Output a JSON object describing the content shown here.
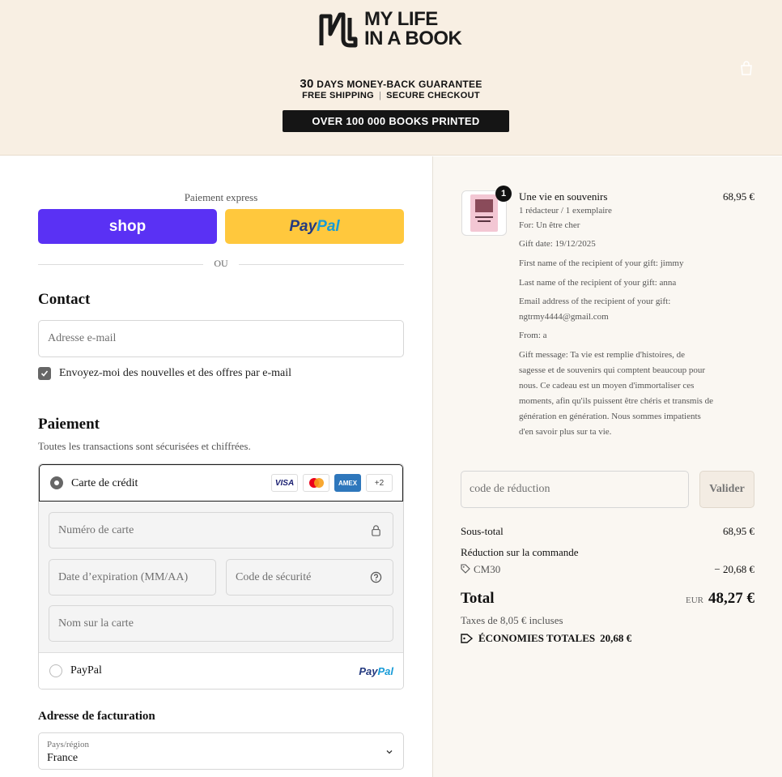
{
  "header": {
    "brand_line1": "MY LIFE",
    "brand_line2": "IN A BOOK",
    "guarantee_days": "30",
    "guarantee_text": "DAYS MONEY-BACK GUARANTEE",
    "shipping": "FREE SHIPPING",
    "secure": "SECURE CHECKOUT",
    "banner": "OVER 100 000 BOOKS PRINTED",
    "cart_icon": "shopping-bag-icon"
  },
  "express": {
    "label": "Paiement express",
    "shop_label": "shop",
    "paypal_a": "Pay",
    "paypal_b": "Pal",
    "or": "OU"
  },
  "contact": {
    "title": "Contact",
    "email_placeholder": "Adresse e-mail",
    "newsletter": "Envoyez-moi des nouvelles et des offres par e-mail",
    "newsletter_checked": true
  },
  "payment": {
    "title": "Paiement",
    "subtitle": "Toutes les transactions sont sécurisées et chiffrées.",
    "card_option": "Carte de crédit",
    "card_brands": [
      "VISA",
      "MC",
      "AMEX",
      "+2"
    ],
    "card_number": "Numéro de carte",
    "expiry": "Date d’expiration (MM/AA)",
    "cvc": "Code de sécurité",
    "name_on_card": "Nom sur la carte",
    "paypal_option": "PayPal",
    "paypal_logo_a": "Pay",
    "paypal_logo_b": "Pal"
  },
  "billing": {
    "title": "Adresse de facturation",
    "country_label": "Pays/région",
    "country_value": "France"
  },
  "order": {
    "quantity": "1",
    "product_name": "Une vie en souvenirs",
    "product_price": "68,95 €",
    "properties": [
      "1 rédacteur / 1 exemplaire",
      "For: Un être cher",
      "Gift date: 19/12/2025",
      "First name of the recipient of your gift: jimmy",
      "Last name of the recipient of your gift: anna",
      "Email address of the recipient of your gift: ngtrmy4444@gmail.com",
      "From: a",
      "Gift message: Ta vie est remplie d'histoires, de sagesse et de souvenirs qui comptent beaucoup pour nous. Ce cadeau est un moyen d'immortaliser ces moments, afin qu'ils puissent être chéris et transmis de génération en génération. Nous sommes impatients d'en savoir plus sur ta vie."
    ],
    "discount_placeholder": "code de réduction",
    "apply_label": "Valider",
    "subtotal_label": "Sous-total",
    "subtotal_value": "68,95 €",
    "reduction_label": "Réduction sur la commande",
    "code": "CM30",
    "reduction_value": "− 20,68 €",
    "total_label": "Total",
    "currency": "EUR",
    "total_value": "48,27 €",
    "tax_text": "Taxes de 8,05 € incluses",
    "savings_label": "ÉCONOMIES TOTALES",
    "savings_value": "20,68 €"
  }
}
